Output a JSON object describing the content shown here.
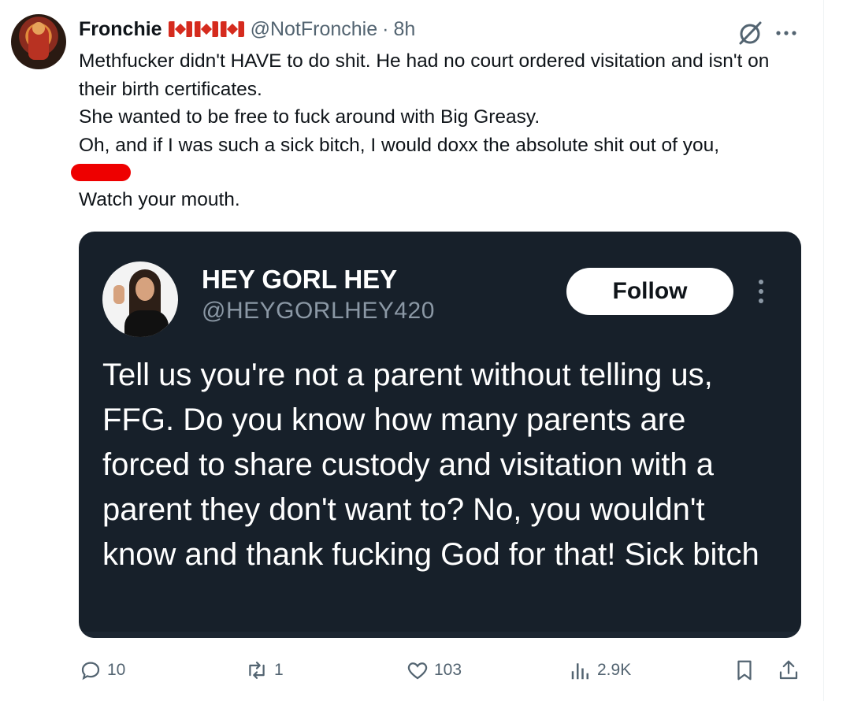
{
  "author": {
    "name": "Fronchie",
    "flags": [
      "canada-flag",
      "canada-flag",
      "canada-flag"
    ],
    "handle": "@NotFronchie",
    "separator": "·",
    "time": "8h"
  },
  "tweet": {
    "lines": [
      "Methfucker didn't HAVE to do shit. He had no court ordered visitation and isn't on their birth certificates.",
      "She wanted to be free to fuck around with Big Greasy.",
      "Oh, and if I was such a sick bitch, I would doxx the absolute shit out of you,"
    ],
    "closing": "Watch your mouth."
  },
  "quoted": {
    "name": "HEY GORL HEY",
    "handle": "@HEYGORLHEY420",
    "follow_label": "Follow",
    "text": "Tell us you're not a parent without telling us, FFG. Do you know how many parents are forced to share custody and visitation with a parent they don't want to? No, you wouldn't know and thank fucking God for that! Sick bitch"
  },
  "actions": {
    "replies": "10",
    "reposts": "1",
    "likes": "103",
    "views": "2.9K"
  },
  "colors": {
    "text": "#0f1419",
    "muted": "#536471",
    "embed_bg": "#17202a",
    "redaction": "#ee0000"
  }
}
